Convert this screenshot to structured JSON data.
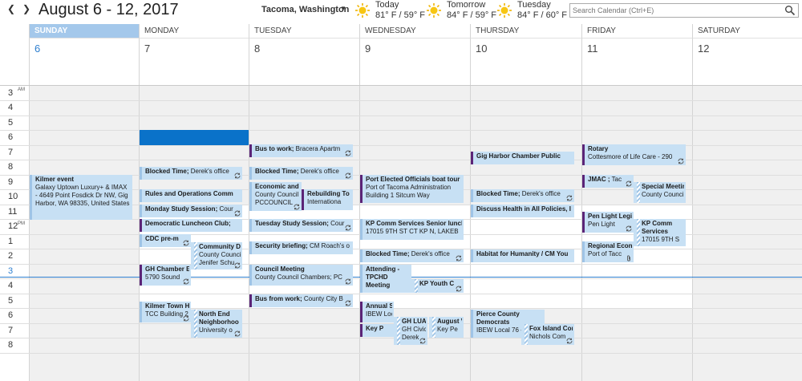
{
  "header": {
    "title": "August 6 - 12, 2017",
    "location": "Tacoma, Washington",
    "weather": [
      {
        "day": "Today",
        "temp": "81° F / 59° F",
        "icon": "sun-icon"
      },
      {
        "day": "Tomorrow",
        "temp": "84° F / 59° F",
        "icon": "sun-icon"
      },
      {
        "day": "Tuesday",
        "temp": "84° F / 60° F",
        "icon": "sun-icon"
      }
    ],
    "search_placeholder": "Search Calendar (Ctrl+E)"
  },
  "days": [
    {
      "name": "SUNDAY",
      "num": "6",
      "today": true
    },
    {
      "name": "MONDAY",
      "num": "7"
    },
    {
      "name": "TUESDAY",
      "num": "8"
    },
    {
      "name": "WEDNESDAY",
      "num": "9"
    },
    {
      "name": "THURSDAY",
      "num": "10"
    },
    {
      "name": "FRIDAY",
      "num": "11"
    },
    {
      "name": "SATURDAY",
      "num": "12"
    }
  ],
  "hours": [
    {
      "label": "3",
      "suffix": "AM"
    },
    {
      "label": "4"
    },
    {
      "label": "5"
    },
    {
      "label": "6"
    },
    {
      "label": "7"
    },
    {
      "label": "8"
    },
    {
      "label": "9"
    },
    {
      "label": "10"
    },
    {
      "label": "11"
    },
    {
      "label": "12",
      "suffix": "PM"
    },
    {
      "label": "1"
    },
    {
      "label": "2"
    },
    {
      "label": "3",
      "now": true
    },
    {
      "label": "4"
    },
    {
      "label": "5"
    },
    {
      "label": "6"
    },
    {
      "label": "7"
    },
    {
      "label": "8"
    }
  ],
  "events": {
    "sun_kilmer": {
      "title": "Kilmer event",
      "detail": "Galaxy Uptown Luxury+ & IMAX - 4649 Point Fosdick Dr NW, Gig Harbor, WA 98335, United States"
    },
    "mon_blocked": {
      "title": "Blocked Time;",
      "detail": " Derek's office"
    },
    "mon_rules": {
      "title": "Rules and Operations Comm"
    },
    "mon_study": {
      "title": "Monday Study Session;",
      "detail": " Cour"
    },
    "mon_demlunch": {
      "title": "Democratic Luncheon Club;"
    },
    "mon_cdc": {
      "title": "CDC pre-m"
    },
    "mon_community": {
      "title": "Community D",
      "detail1": "County Council",
      "detail2": "Jenifer Schu"
    },
    "mon_ghchamber": {
      "title": "GH Chamber E",
      "detail": "5790 Sound"
    },
    "mon_kilmertown": {
      "title": "Kilmer Town H",
      "detail": "TCC Building 2"
    },
    "mon_northend": {
      "title": "North End Neighborhoo",
      "detail": "University o"
    },
    "tue_bus": {
      "title": "Bus to work;",
      "detail": " Bracera Apartm"
    },
    "tue_blocked": {
      "title": "Blocked Time;",
      "detail": " Derek's office"
    },
    "tue_econ": {
      "title": "Economic and",
      "detail1": "County Council",
      "detail2": "PCCOUNCIL"
    },
    "tue_rebuild": {
      "title": "Rebuilding To",
      "detail": "Internationa"
    },
    "tue_study": {
      "title": "Tuesday Study Session;",
      "detail": " Cour"
    },
    "tue_security": {
      "title": "Security briefing;",
      "detail": " CM Roach's o"
    },
    "tue_council": {
      "title": "Council Meeting",
      "detail": "County Council Chambers; PC"
    },
    "tue_busfrom": {
      "title": "Bus from work;",
      "detail": " County City B"
    },
    "wed_portboat": {
      "title": "Port Elected Officials boat tour",
      "detail1": "Port of Tacoma Administration",
      "detail2": "Building 1 Sitcum Way"
    },
    "wed_kpcomm": {
      "title": "KP Comm Services Senior lunch",
      "detail": "17015 9TH ST CT KP N, LAKEB"
    },
    "wed_blocked": {
      "title": "Blocked Time;",
      "detail": " Derek's office"
    },
    "wed_attending": {
      "title": "Attending - TPCHD Meeting"
    },
    "wed_kpyouth": {
      "title": "KP Youth C"
    },
    "wed_annual": {
      "title": "Annual S",
      "detail": "IBEW Loc"
    },
    "wed_keyp": {
      "title": "Key P"
    },
    "wed_ghluac": {
      "title": "GH LUAC",
      "detail1": "GH Civic",
      "detail2": "Derek"
    },
    "wed_august": {
      "title": "August V",
      "detail": "Key Pe"
    },
    "thu_ghchamber": {
      "title": "Gig Harbor Chamber Public"
    },
    "thu_blocked": {
      "title": "Blocked Time;",
      "detail": " Derek's office"
    },
    "thu_health": {
      "title": "Discuss Health in All Policies, I"
    },
    "thu_habitat": {
      "title": "Habitat for Humanity / CM You"
    },
    "thu_pierce": {
      "title": "Pierce County Democrats",
      "detail": "IBEW Local 76 -"
    },
    "thu_foxisland": {
      "title": "Fox Island Cor",
      "detail": "Nichols Com"
    },
    "fri_rotary": {
      "title": "Rotary",
      "detail": "Cottesmore of Life Care - 290"
    },
    "fri_jmac": {
      "title": "JMAC ;",
      "detail": " Tac"
    },
    "fri_special": {
      "title": "Special Meetir",
      "detail": "County Council"
    },
    "fri_penlight": {
      "title": "Pen Light Legi",
      "detail": "Pen Light"
    },
    "fri_kpcomm": {
      "title": "KP Comm Services",
      "detail": "17015 9TH S"
    },
    "fri_regional": {
      "title": "Regional Econ",
      "detail": "Port of Tacc"
    }
  }
}
